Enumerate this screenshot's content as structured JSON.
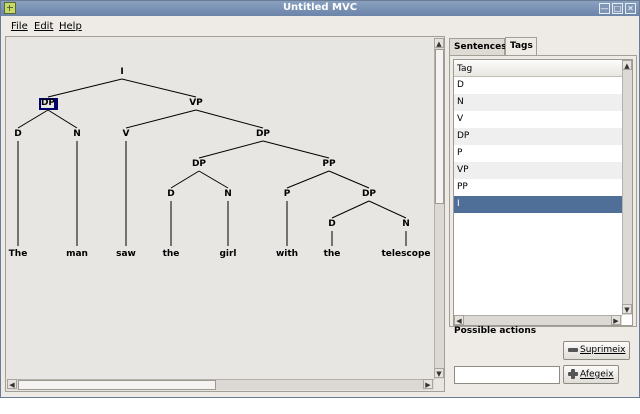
{
  "window": {
    "title": "Untitled MVC"
  },
  "menu": {
    "file": "File",
    "edit": "Edit",
    "help": "Help"
  },
  "tree": {
    "nodes": {
      "I": "I",
      "DP1": "DP",
      "VP": "VP",
      "D1": "D",
      "N1": "N",
      "V": "V",
      "DP2": "DP",
      "DP3": "DP",
      "PP": "PP",
      "D2": "D",
      "N2": "N",
      "P": "P",
      "DP4": "DP",
      "D3": "D",
      "N3": "N"
    },
    "words": {
      "w1": "The",
      "w2": "man",
      "w3": "saw",
      "w4": "the",
      "w5": "girl",
      "w6": "with",
      "w7": "the",
      "w8": "telescope"
    },
    "selected_node": "DP1"
  },
  "tabs": {
    "sentences": "Sentences",
    "tags": "Tags",
    "active": "Tags"
  },
  "tag_list": {
    "header": "Tag",
    "rows": [
      "D",
      "N",
      "V",
      "DP",
      "P",
      "VP",
      "PP",
      "I"
    ],
    "selected": "I"
  },
  "actions": {
    "label": "Possible actions",
    "remove_button": "Suprimeix",
    "add_button": "Afegeix",
    "input_value": ""
  },
  "colors": {
    "selection": "#4f6f98",
    "titlebar": "#7a91b3"
  }
}
